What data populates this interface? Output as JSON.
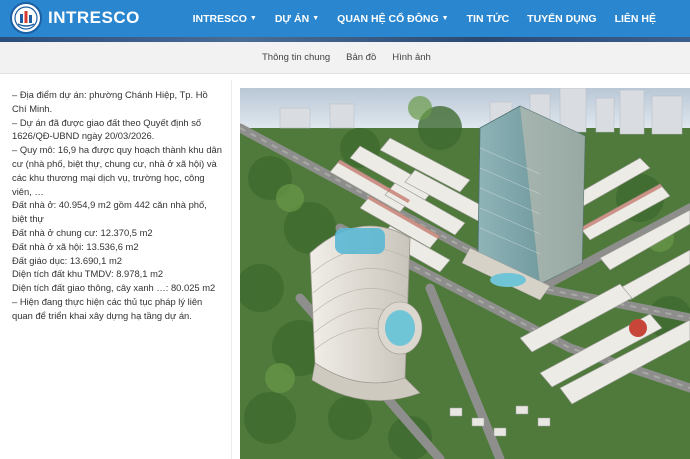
{
  "header": {
    "brand": "INTRESCO",
    "nav": [
      {
        "label": "INTRESCO",
        "has_caret": true
      },
      {
        "label": "DỰ ÁN",
        "has_caret": true
      },
      {
        "label": "QUAN HỆ CỔ ĐÔNG",
        "has_caret": true
      },
      {
        "label": "TIN TỨC",
        "has_caret": false
      },
      {
        "label": "TUYỂN DỤNG",
        "has_caret": false
      },
      {
        "label": "LIÊN HỆ",
        "has_caret": false
      }
    ],
    "bg_color": "#2a86cf"
  },
  "tabs": [
    "Thông tin chung",
    "Bản đồ",
    "Hình ảnh"
  ],
  "info": [
    "– Địa điểm dự án: phường Chánh Hiệp, Tp. Hồ Chí Minh.",
    "– Dự án đã được giao đất theo Quyết định số 1626/QĐ-UBND ngày 20/03/2026.",
    "– Quy mô: 16,9 ha được quy hoạch thành khu dân cư (nhà phố, biệt thự, chung cư, nhà ở xã hội) và các khu thương mại dịch vụ, trường học, công viên, …",
    " Đất nhà ở: 40.954,9 m2 gồm 442 căn nhà phố, biệt thự",
    " Đất nhà ở chung cư: 12.370,5 m2",
    " Đất nhà ở xã hội: 13.536,6 m2",
    " Đất giáo dục: 13.690,1 m2",
    " Diện tích đất khu TMDV: 8.978,1 m2",
    " Diện tích đất giao thông, cây xanh …: 80.025 m2",
    "– Hiện đang thực hiện các thủ tục pháp lý liên quan để triển khai xây dựng hạ tầng dự án."
  ]
}
